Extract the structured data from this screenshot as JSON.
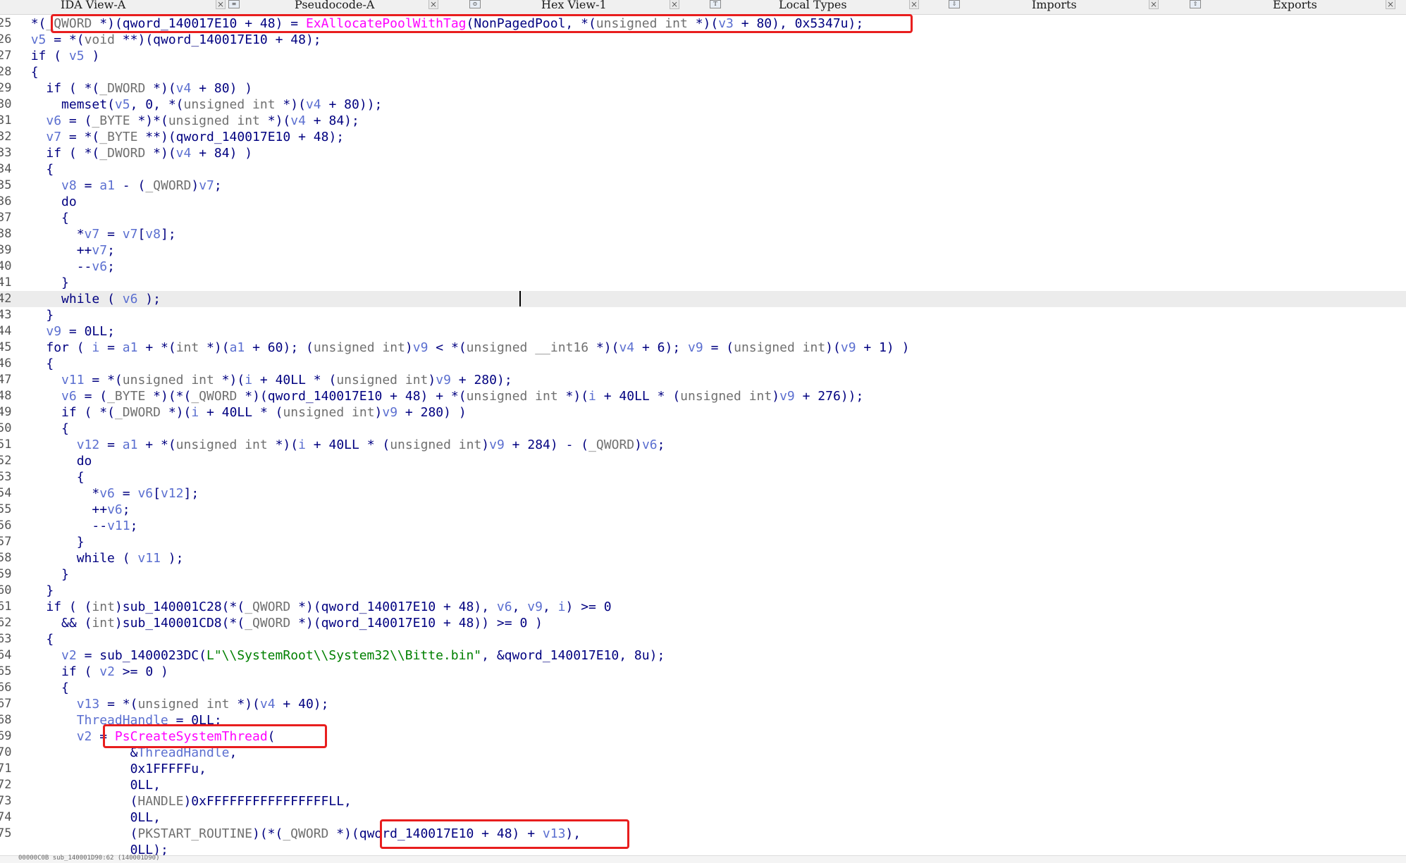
{
  "tabs": [
    {
      "label": "IDA View-A",
      "icon": "ida-view-icon"
    },
    {
      "label": "Pseudocode-A",
      "icon": "pseudocode-icon"
    },
    {
      "label": "Hex View-1",
      "icon": "hex-view-icon"
    },
    {
      "label": "Local Types",
      "icon": "local-types-icon"
    },
    {
      "label": "Imports",
      "icon": "imports-icon"
    },
    {
      "label": "Exports",
      "icon": "exports-icon"
    }
  ],
  "code_lines": [
    {
      "n": "25",
      "text": "  *(_QWORD *)(qword_140017E10 + 48) = ExAllocatePoolWithTag(NonPagedPool, *(unsigned int *)(v3 + 80), 0x5347u);"
    },
    {
      "n": "26",
      "text": "  v5 = *(void **)(qword_140017E10 + 48);"
    },
    {
      "n": "27",
      "text": "  if ( v5 )"
    },
    {
      "n": "28",
      "text": "  {"
    },
    {
      "n": "29",
      "text": "    if ( *(_DWORD *)(v4 + 80) )"
    },
    {
      "n": "30",
      "text": "      memset(v5, 0, *(unsigned int *)(v4 + 80));"
    },
    {
      "n": "31",
      "text": "    v6 = (_BYTE *)*(unsigned int *)(v4 + 84);"
    },
    {
      "n": "32",
      "text": "    v7 = *(_BYTE **)(qword_140017E10 + 48);"
    },
    {
      "n": "33",
      "text": "    if ( *(_DWORD *)(v4 + 84) )"
    },
    {
      "n": "34",
      "text": "    {"
    },
    {
      "n": "35",
      "text": "      v8 = a1 - (_QWORD)v7;"
    },
    {
      "n": "36",
      "text": "      do"
    },
    {
      "n": "37",
      "text": "      {"
    },
    {
      "n": "38",
      "text": "        *v7 = v7[v8];"
    },
    {
      "n": "39",
      "text": "        ++v7;"
    },
    {
      "n": "40",
      "text": "        --v6;"
    },
    {
      "n": "41",
      "text": "      }"
    },
    {
      "n": "42",
      "text": "      while ( v6 );"
    },
    {
      "n": "43",
      "text": "    }"
    },
    {
      "n": "44",
      "text": "    v9 = 0LL;"
    },
    {
      "n": "45",
      "text": "    for ( i = a1 + *(int *)(a1 + 60); (unsigned int)v9 < *(unsigned __int16 *)(v4 + 6); v9 = (unsigned int)(v9 + 1) )"
    },
    {
      "n": "46",
      "text": "    {"
    },
    {
      "n": "47",
      "text": "      v11 = *(unsigned int *)(i + 40LL * (unsigned int)v9 + 280);"
    },
    {
      "n": "48",
      "text": "      v6 = (_BYTE *)(*(_QWORD *)(qword_140017E10 + 48) + *(unsigned int *)(i + 40LL * (unsigned int)v9 + 276));"
    },
    {
      "n": "49",
      "text": "      if ( *(_DWORD *)(i + 40LL * (unsigned int)v9 + 280) )"
    },
    {
      "n": "50",
      "text": "      {"
    },
    {
      "n": "51",
      "text": "        v12 = a1 + *(unsigned int *)(i + 40LL * (unsigned int)v9 + 284) - (_QWORD)v6;"
    },
    {
      "n": "52",
      "text": "        do"
    },
    {
      "n": "53",
      "text": "        {"
    },
    {
      "n": "54",
      "text": "          *v6 = v6[v12];"
    },
    {
      "n": "55",
      "text": "          ++v6;"
    },
    {
      "n": "56",
      "text": "          --v11;"
    },
    {
      "n": "57",
      "text": "        }"
    },
    {
      "n": "58",
      "text": "        while ( v11 );"
    },
    {
      "n": "59",
      "text": "      }"
    },
    {
      "n": "60",
      "text": "    }"
    },
    {
      "n": "61",
      "text": "    if ( (int)sub_140001C28(*(_QWORD *)(qword_140017E10 + 48), v6, v9, i) >= 0"
    },
    {
      "n": "62",
      "text": "      && (int)sub_140001CD8(*(_QWORD *)(qword_140017E10 + 48)) >= 0 )"
    },
    {
      "n": "63",
      "text": "    {"
    },
    {
      "n": "64",
      "text": "      v2 = sub_1400023DC(L\"\\\\SystemRoot\\\\System32\\\\Bitte.bin\", &qword_140017E10, 8u);"
    },
    {
      "n": "65",
      "text": "      if ( v2 >= 0 )"
    },
    {
      "n": "66",
      "text": "      {"
    },
    {
      "n": "67",
      "text": "        v13 = *(unsigned int *)(v4 + 40);"
    },
    {
      "n": "68",
      "text": "        ThreadHandle = 0LL;"
    },
    {
      "n": "69",
      "text": "        v2 = PsCreateSystemThread("
    },
    {
      "n": "70",
      "text": "               &ThreadHandle,"
    },
    {
      "n": "71",
      "text": "               0x1FFFFFu,"
    },
    {
      "n": "72",
      "text": "               0LL,"
    },
    {
      "n": "73",
      "text": "               (HANDLE)0xFFFFFFFFFFFFFFFFLL,"
    },
    {
      "n": "74",
      "text": "               0LL,"
    },
    {
      "n": "75",
      "text": "               (PKSTART_ROUTINE)(*(_QWORD *)(qword_140017E10 + 48) + v13),"
    },
    {
      "n": "",
      "text": "               0LL);"
    }
  ],
  "status_text": "00000C0B sub_140001D90:62 (140001D90)",
  "colors": {
    "highlight_box": "#e81e1e",
    "api_call": "#ff00ff",
    "string_literal": "#008000",
    "variable": "#5b6fd0",
    "code_default": "#000080"
  }
}
